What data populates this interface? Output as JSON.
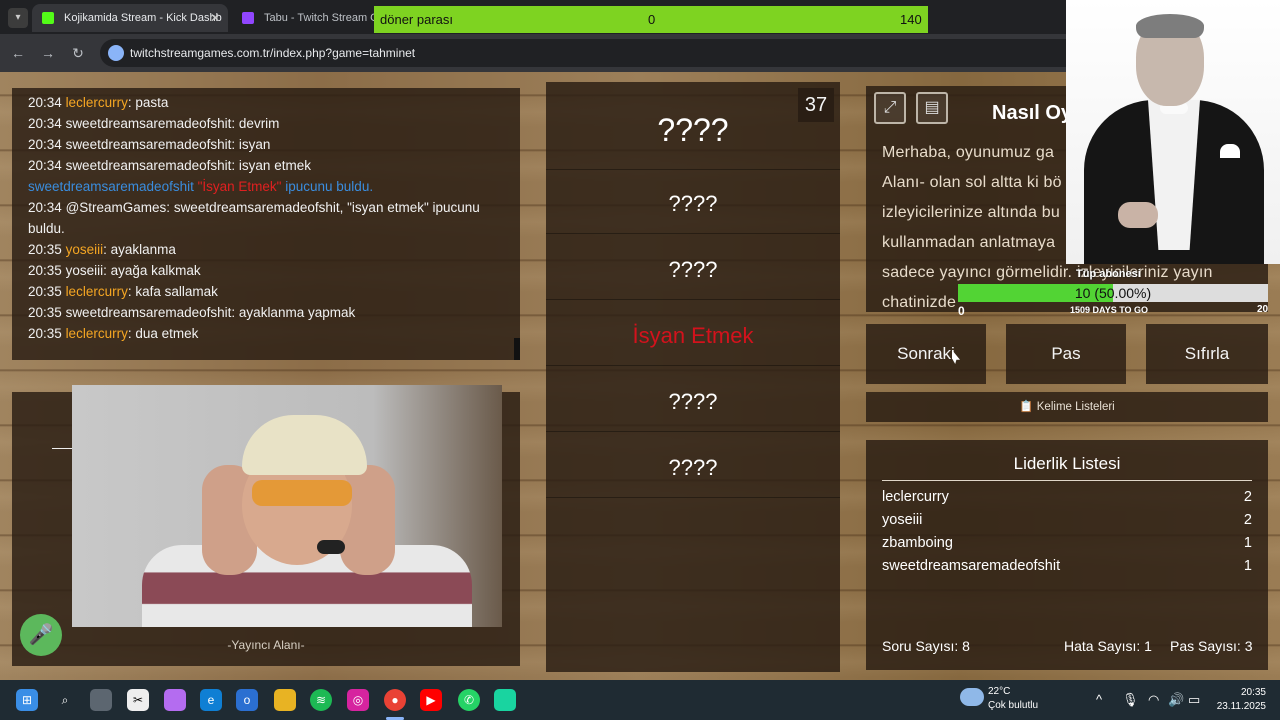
{
  "browser": {
    "tabs": [
      {
        "label": "Kojikamida Stream - Kick Dashb",
        "icon_color": "#53fc18"
      },
      {
        "label": "Tabu - Twitch Stream Gam",
        "icon_color": "#9146ff"
      }
    ],
    "url": "twitchstreamgames.com.tr/index.php?game=tahminet"
  },
  "doner": {
    "label": "döner parası",
    "current": "0",
    "goal": "140"
  },
  "chat": [
    {
      "time": "20:34",
      "user": "leclercurry",
      "user_color": "orange",
      "text": "pasta"
    },
    {
      "time": "20:34",
      "user": "sweetdreamsaremadeofshit",
      "user_color": "plain",
      "text": "devrim"
    },
    {
      "time": "20:34",
      "user": "sweetdreamsaremadeofshit",
      "user_color": "plain",
      "text": "isyan"
    },
    {
      "time": "20:34",
      "user": "sweetdreamsaremadeofshit",
      "user_color": "plain",
      "text": "isyan etmek"
    },
    {
      "system": true,
      "user": "sweetdreamsaremadeofshit",
      "word": "\"İsyan Etmek\"",
      "suffix": "ipucunu buldu."
    },
    {
      "time": "20:34",
      "user": "@StreamGames",
      "user_color": "plain",
      "text": "sweetdreamsaremadeofshit, \"isyan etmek\" ipucunu buldu."
    },
    {
      "time": "20:35",
      "user": "yoseiii",
      "user_color": "orange",
      "text": "ayaklanma"
    },
    {
      "time": "20:35",
      "user": "yoseiii",
      "user_color": "plain",
      "text": "ayağa kalkmak"
    },
    {
      "time": "20:35",
      "user": "leclercurry",
      "user_color": "orange",
      "text": "kafa sallamak"
    },
    {
      "time": "20:35",
      "user": "sweetdreamsaremadeofshit",
      "user_color": "plain",
      "text": "ayaklanma yapmak"
    },
    {
      "time": "20:35",
      "user": "leclercurry",
      "user_color": "orange",
      "text": "dua etmek"
    }
  ],
  "streamer_label": "-Yayıncı Alanı-",
  "words": {
    "counter": "37",
    "items": [
      "????",
      "????",
      "????",
      "İsyan Etmek",
      "????",
      "????"
    ]
  },
  "howto": {
    "title": "Nasıl Oy",
    "lines": [
      "Merhaba, oyunumuz ga",
      "Alanı- olan sol altta ki bö",
      "izleyicilerinize altında bu",
      "kullanmadan anlatmaya",
      "sadece yayıncı görmelidir. izleyicileriniz yayın",
      "chatinizde"
    ]
  },
  "sub_goal": {
    "title": "Tüp abonesi",
    "text": "10 (50.00%)",
    "progress": 0.5,
    "min": "0",
    "mid": "1509 DAYS TO GO",
    "max": "20"
  },
  "buttons": {
    "next": "Sonraki",
    "pass": "Pas",
    "reset": "Sıfırla"
  },
  "word_lists": "Kelime Listeleri",
  "leaderboard": {
    "title": "Liderlik Listesi",
    "rows": [
      {
        "name": "leclercurry",
        "score": "2"
      },
      {
        "name": "yoseiii",
        "score": "2"
      },
      {
        "name": "zbamboing",
        "score": "1"
      },
      {
        "name": "sweetdreamsaremadeofshit",
        "score": "1"
      }
    ]
  },
  "stats": {
    "questions": "Soru Sayısı: 8",
    "errors": "Hata Sayısı: 1",
    "passes": "Pas Sayısı: 3"
  },
  "taskbar": {
    "weather_temp": "22°C",
    "weather_desc": "Çok bulutlu",
    "time": "20:35",
    "date": "23.11.2025"
  },
  "colors": {
    "accent_green": "#7ed321",
    "word_found": "#d3121c",
    "chat_orange": "#f5a623",
    "chat_blue": "#3a8dde"
  }
}
